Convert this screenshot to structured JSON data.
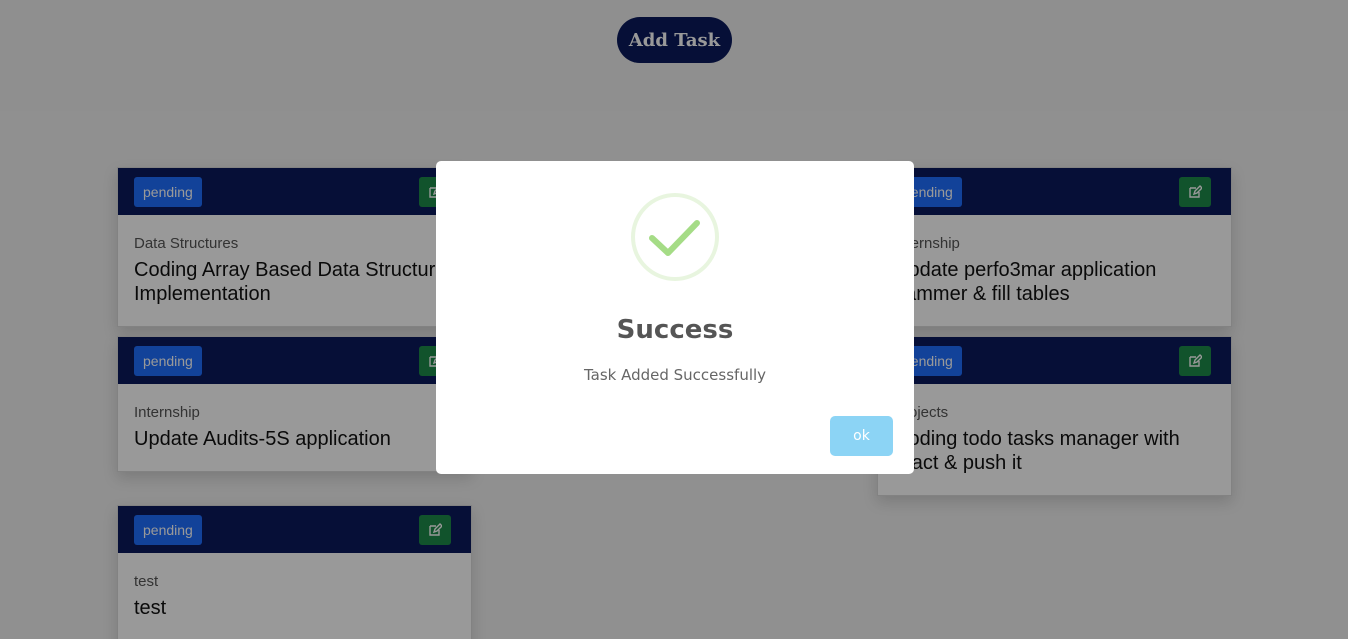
{
  "header": {
    "add_task_label": "Add Task"
  },
  "cards": [
    {
      "status": "pending",
      "category": "Data Structures",
      "title": "Coding Array Based Data Structure Implementation"
    },
    {
      "status": "pending",
      "category": "Internship",
      "title": "Update Audits-5S application"
    },
    {
      "status": "pending",
      "category": "test",
      "title": "test"
    },
    {
      "status": "pending",
      "category": "Internship",
      "title": "Update perfo3mar application hammer & fill tables"
    },
    {
      "status": "pending",
      "category": "Projects",
      "title": "Coding todo tasks manager with react & push it"
    }
  ],
  "modal": {
    "icon": "success-check-icon",
    "title": "Success",
    "message": "Task Added Successfully",
    "ok_label": "ok"
  },
  "colors": {
    "navy": "#0a1a5c",
    "badge_blue": "#1f6fff",
    "edit_green": "#1d8a4a",
    "check_green": "#a5dc86",
    "ok_button": "#8cd4f5"
  }
}
